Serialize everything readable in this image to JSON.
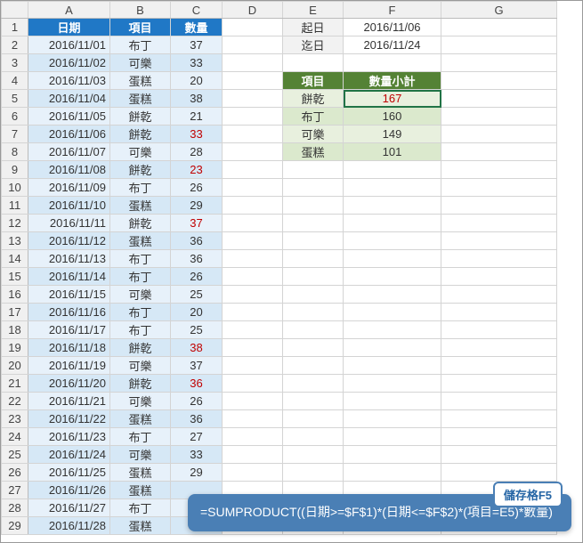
{
  "cols": [
    "A",
    "B",
    "C",
    "D",
    "E",
    "F",
    "G"
  ],
  "main_header": {
    "a": "日期",
    "b": "項目",
    "c": "數量"
  },
  "rows": [
    {
      "d": "2016/11/01",
      "i": "布丁",
      "q": "37",
      "alt": 0
    },
    {
      "d": "2016/11/02",
      "i": "可樂",
      "q": "33",
      "alt": 1
    },
    {
      "d": "2016/11/03",
      "i": "蛋糕",
      "q": "20",
      "alt": 0
    },
    {
      "d": "2016/11/04",
      "i": "蛋糕",
      "q": "38",
      "alt": 1
    },
    {
      "d": "2016/11/05",
      "i": "餅乾",
      "q": "21",
      "alt": 0
    },
    {
      "d": "2016/11/06",
      "i": "餅乾",
      "q": "33",
      "alt": 1,
      "red": true
    },
    {
      "d": "2016/11/07",
      "i": "可樂",
      "q": "28",
      "alt": 0
    },
    {
      "d": "2016/11/08",
      "i": "餅乾",
      "q": "23",
      "alt": 1,
      "red": true
    },
    {
      "d": "2016/11/09",
      "i": "布丁",
      "q": "26",
      "alt": 0
    },
    {
      "d": "2016/11/10",
      "i": "蛋糕",
      "q": "29",
      "alt": 1
    },
    {
      "d": "2016/11/11",
      "i": "餅乾",
      "q": "37",
      "alt": 0,
      "red": true
    },
    {
      "d": "2016/11/12",
      "i": "蛋糕",
      "q": "36",
      "alt": 1
    },
    {
      "d": "2016/11/13",
      "i": "布丁",
      "q": "36",
      "alt": 0
    },
    {
      "d": "2016/11/14",
      "i": "布丁",
      "q": "26",
      "alt": 1
    },
    {
      "d": "2016/11/15",
      "i": "可樂",
      "q": "25",
      "alt": 0
    },
    {
      "d": "2016/11/16",
      "i": "布丁",
      "q": "20",
      "alt": 1
    },
    {
      "d": "2016/11/17",
      "i": "布丁",
      "q": "25",
      "alt": 0
    },
    {
      "d": "2016/11/18",
      "i": "餅乾",
      "q": "38",
      "alt": 1,
      "red": true
    },
    {
      "d": "2016/11/19",
      "i": "可樂",
      "q": "37",
      "alt": 0
    },
    {
      "d": "2016/11/20",
      "i": "餅乾",
      "q": "36",
      "alt": 1,
      "red": true
    },
    {
      "d": "2016/11/21",
      "i": "可樂",
      "q": "26",
      "alt": 0
    },
    {
      "d": "2016/11/22",
      "i": "蛋糕",
      "q": "36",
      "alt": 1
    },
    {
      "d": "2016/11/23",
      "i": "布丁",
      "q": "27",
      "alt": 0
    },
    {
      "d": "2016/11/24",
      "i": "可樂",
      "q": "33",
      "alt": 1
    },
    {
      "d": "2016/11/25",
      "i": "蛋糕",
      "q": "29",
      "alt": 0
    },
    {
      "d": "2016/11/26",
      "i": "蛋糕",
      "q": "",
      "alt": 1
    },
    {
      "d": "2016/11/27",
      "i": "布丁",
      "q": "",
      "alt": 0
    },
    {
      "d": "2016/11/28",
      "i": "蛋糕",
      "q": "",
      "alt": 1
    }
  ],
  "range": {
    "start_label": "起日",
    "start": "2016/11/06",
    "end_label": "迄日",
    "end": "2016/11/24"
  },
  "summary_header": {
    "item": "項目",
    "subtotal": "數量小計"
  },
  "summary": [
    {
      "i": "餅乾",
      "q": "167",
      "alt": 0,
      "red": true,
      "sel": true
    },
    {
      "i": "布丁",
      "q": "160",
      "alt": 1
    },
    {
      "i": "可樂",
      "q": "149",
      "alt": 0
    },
    {
      "i": "蛋糕",
      "q": "101",
      "alt": 1
    }
  ],
  "callout": {
    "cell": "儲存格F5",
    "formula": "=SUMPRODUCT((日期>=$F$1)*(日期<=$F$2)*(項目=E5)*數量)"
  }
}
